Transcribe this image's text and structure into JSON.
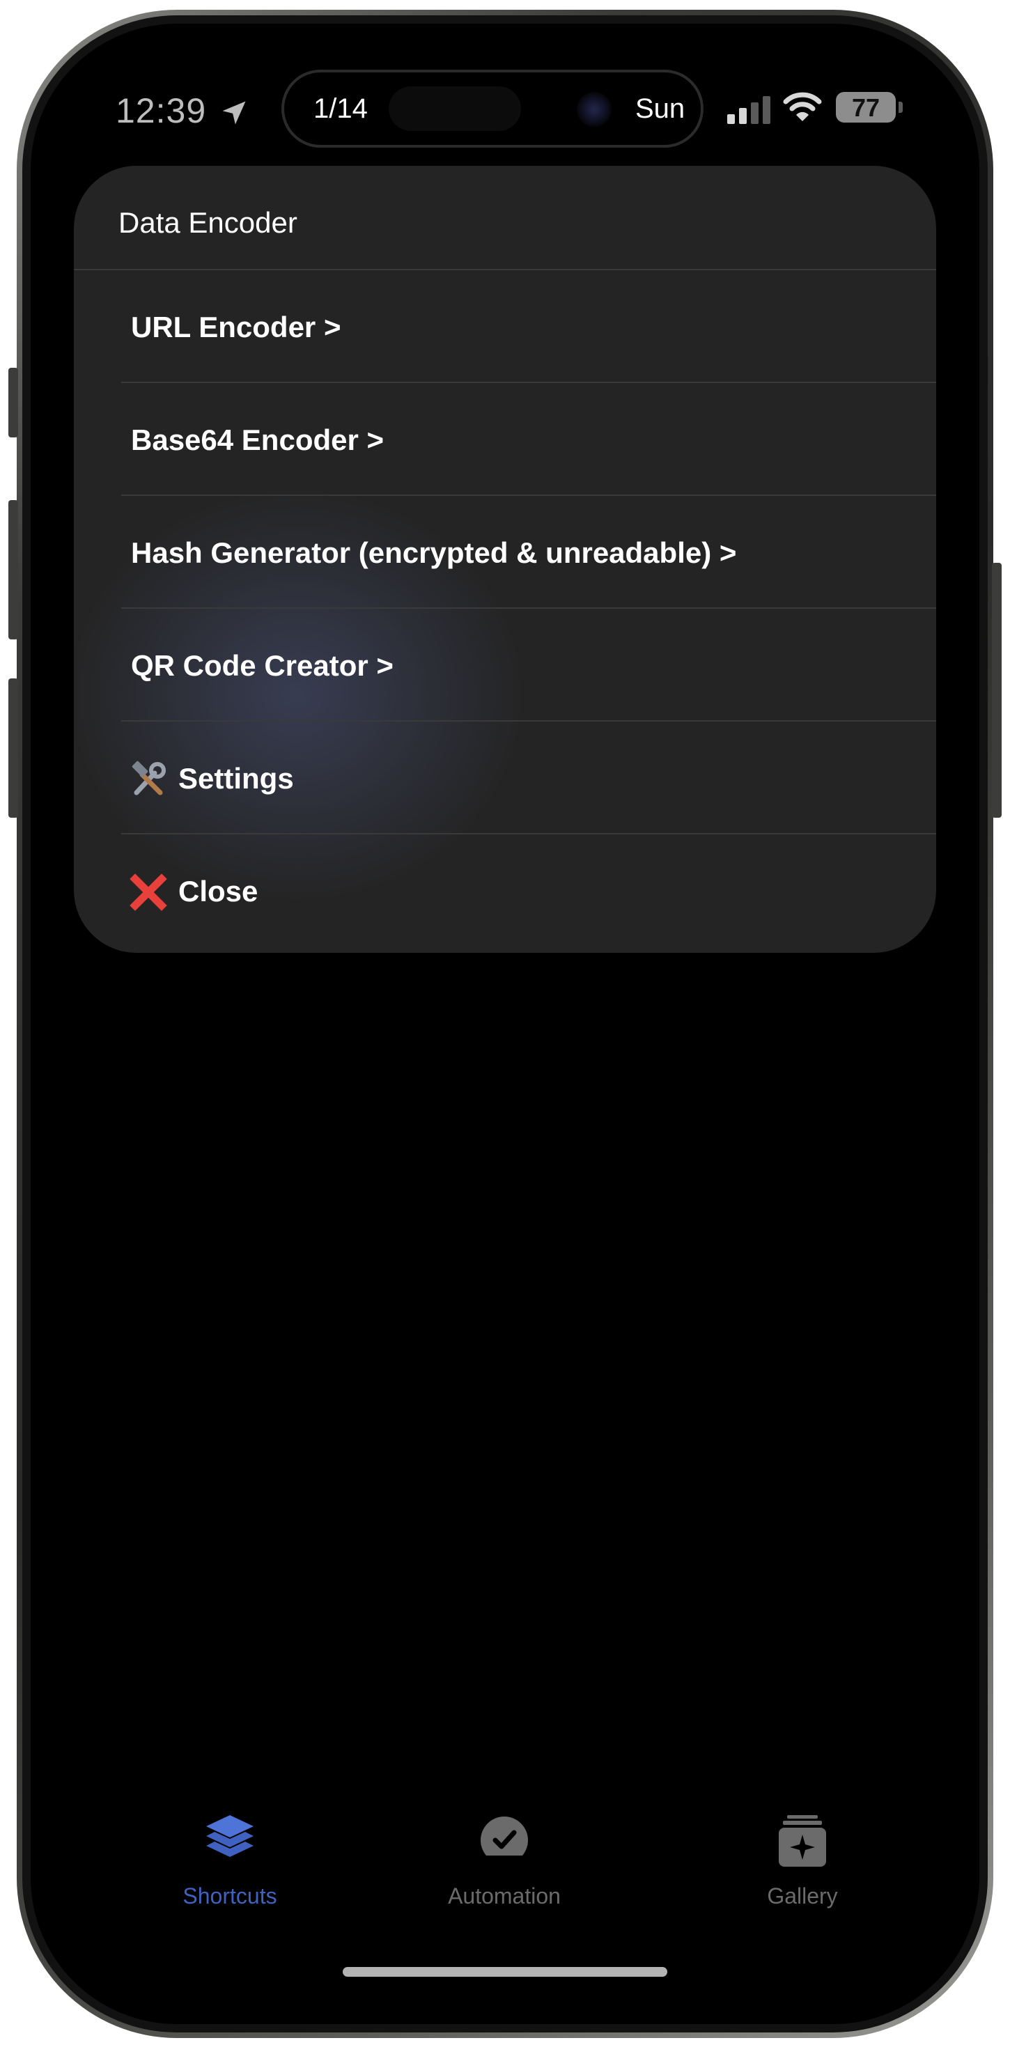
{
  "status_bar": {
    "time": "12:39",
    "activity_counter": "1/14",
    "activity_day": "Sun",
    "battery_level": "77"
  },
  "menu": {
    "title": "Data Encoder",
    "items": [
      {
        "label": "URL Encoder >"
      },
      {
        "label": "Base64 Encoder >"
      },
      {
        "label": "Hash Generator (encrypted & unreadable) >"
      },
      {
        "label": "QR Code Creator >"
      },
      {
        "label": "Settings",
        "icon": "hammer-and-wrench-icon"
      },
      {
        "label": "Close",
        "icon": "red-x-icon"
      }
    ]
  },
  "tab_bar": {
    "tabs": [
      {
        "label": "Shortcuts",
        "icon": "stacked-layers-icon",
        "active": true
      },
      {
        "label": "Automation",
        "icon": "clock-check-icon",
        "active": false
      },
      {
        "label": "Gallery",
        "icon": "gallery-sparkle-icon",
        "active": false
      }
    ]
  },
  "colors": {
    "active_tab": "#3f62c1",
    "inactive_tab": "#6b6b6b",
    "menu_background": "#242424",
    "close_icon": "#e8413b"
  }
}
